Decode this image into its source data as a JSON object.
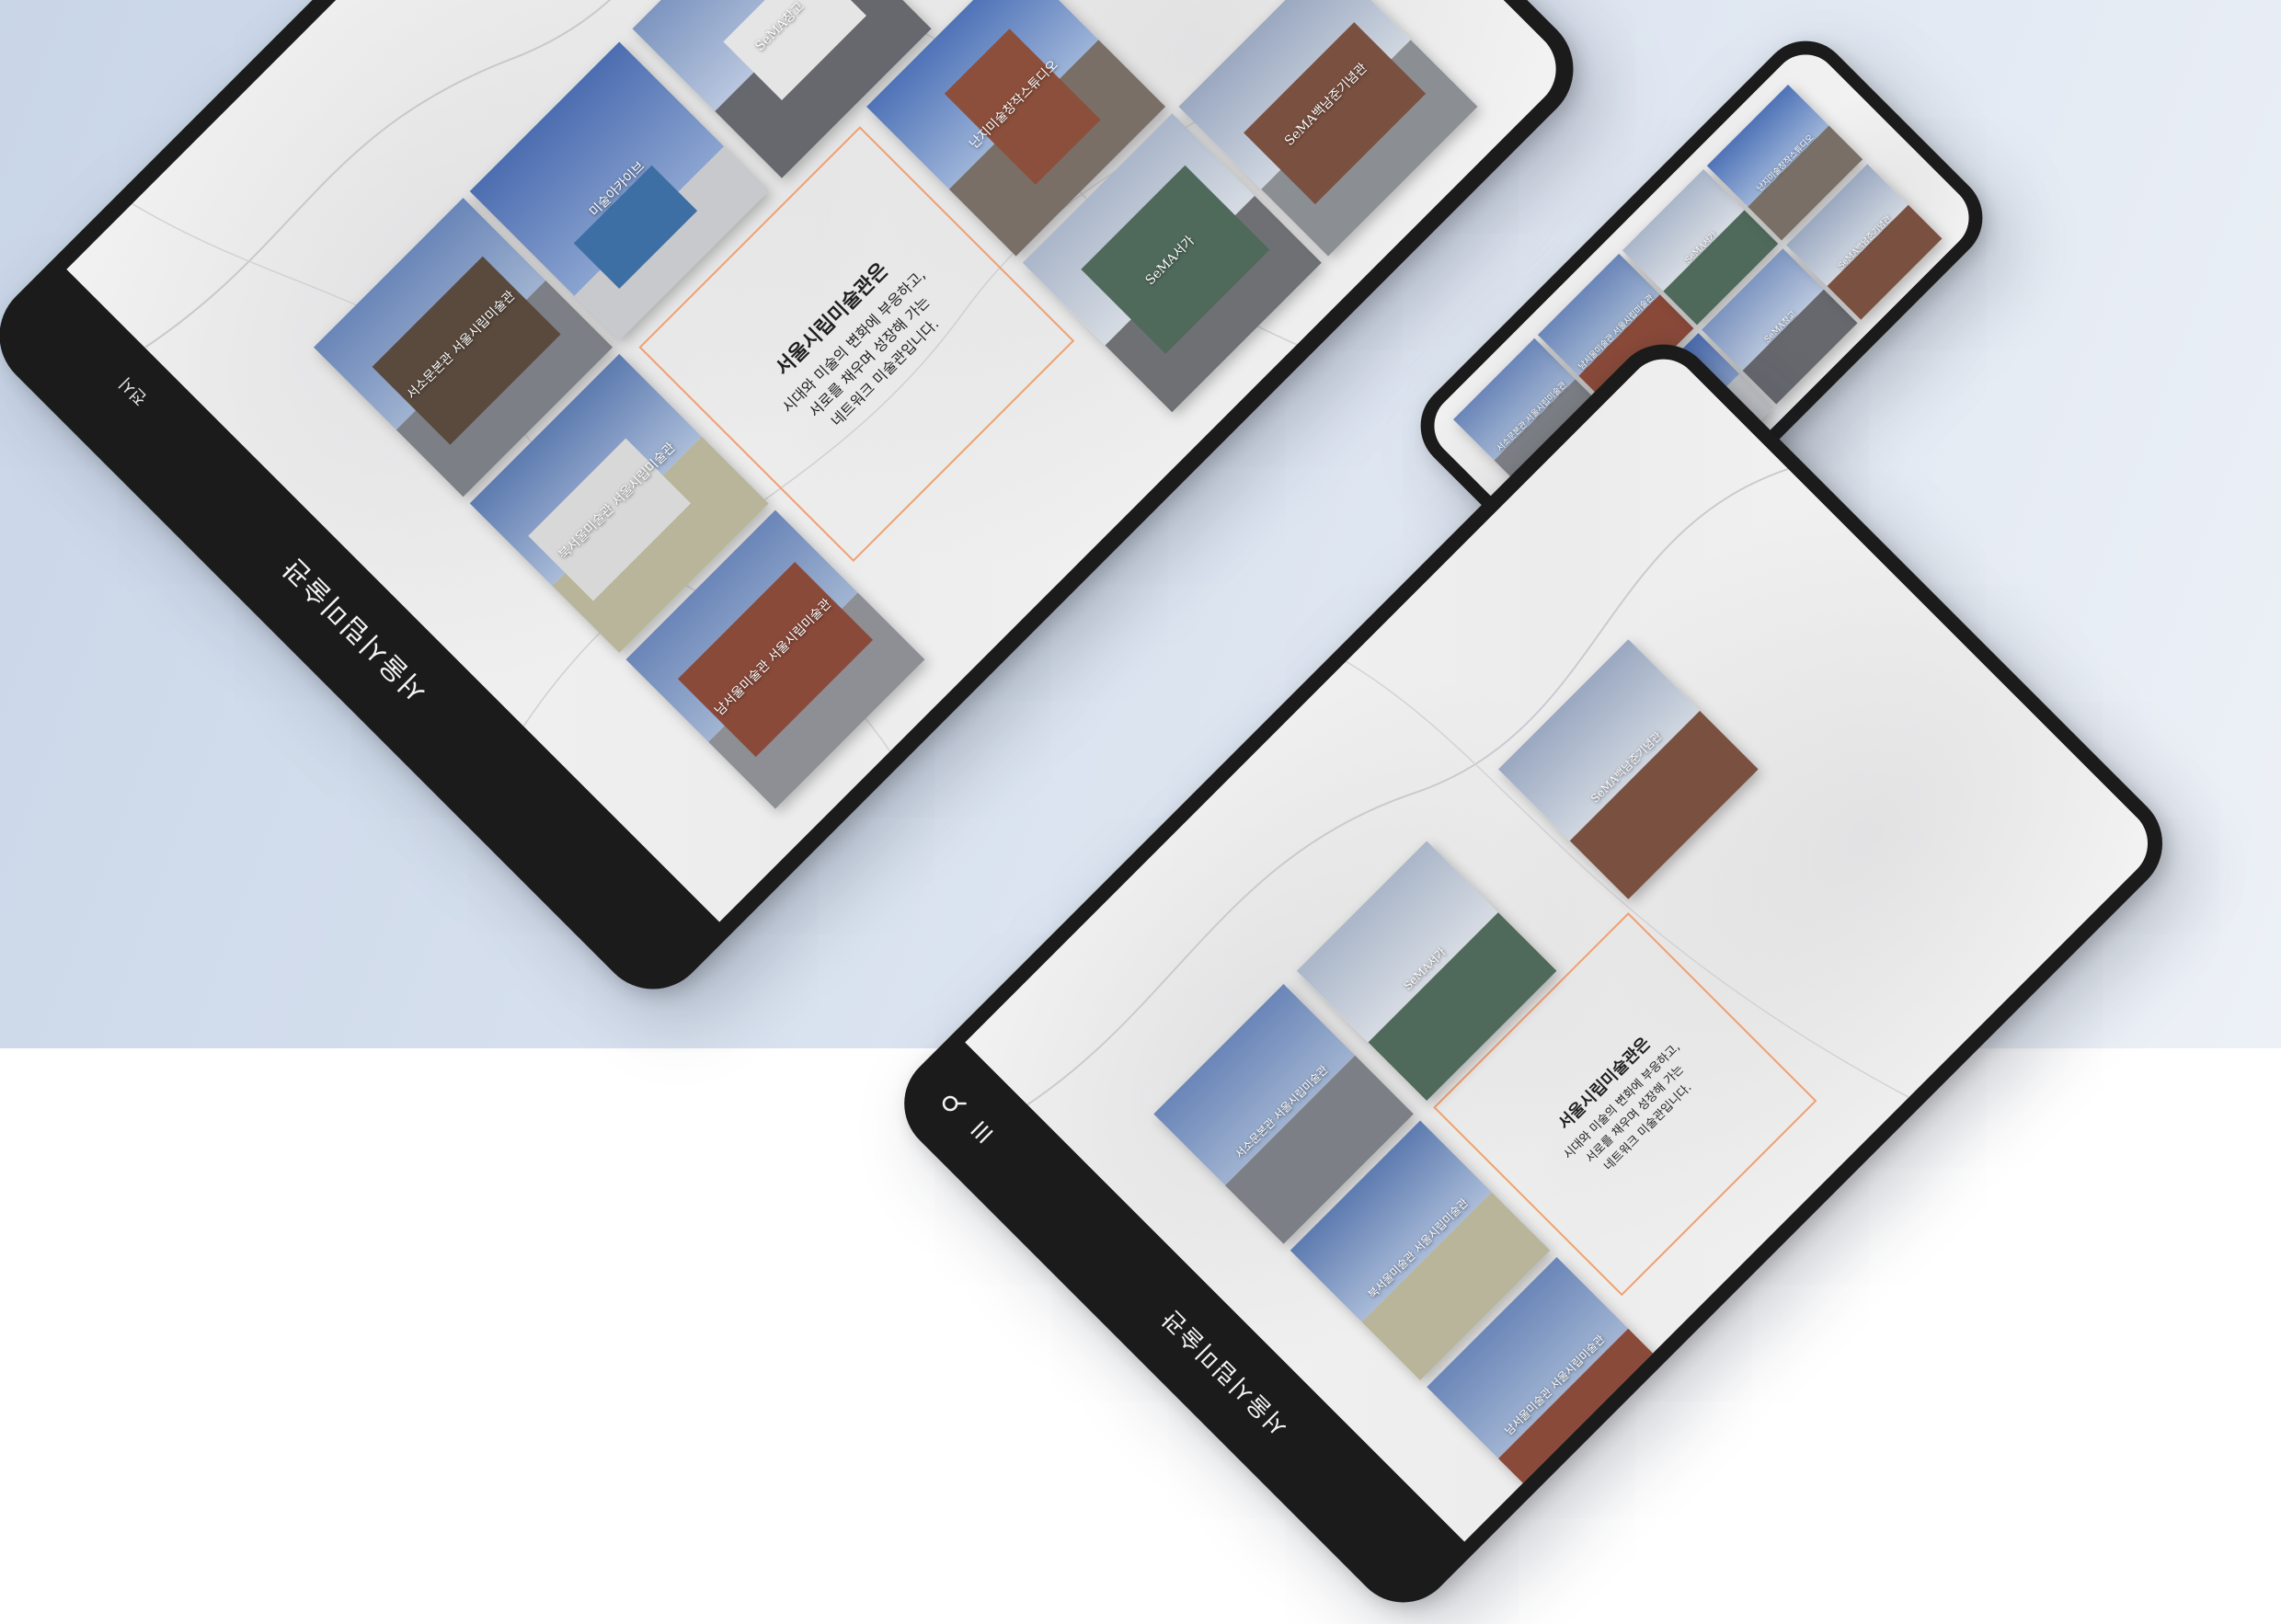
{
  "site_title": "서울시립미술관",
  "nav": {
    "exhibitions": "전시"
  },
  "intro": {
    "title": "서울시립미술관은",
    "lines": [
      "시대와 미술의 변화에 부응하고,",
      "서로를 채우며 성장해 가는",
      "네트워크 미술관입니다."
    ]
  },
  "venues": {
    "seosomun": "서소문본관 서울시립미술관",
    "buk_seoul": "북서울미술관 서울시립미술관",
    "nam_seoul": "남서울미술관 서울시립미술관",
    "archive": "미술아카이브",
    "soma_seoga": "SeMA서가",
    "soma_nam": "SeMA벙커",
    "soma_warehouse": "SeMA창고",
    "nanji": "난지미술창작스튜디오",
    "soma_baeknam": "SeMA백남준기념관"
  },
  "icons": {
    "search": "search-icon",
    "menu": "hamburger-menu-icon"
  },
  "colors": {
    "frame": "#1b1b1b",
    "accent_border": "#f0a070",
    "sky": "#5d7bb0",
    "brick": "#8a4a3a"
  }
}
